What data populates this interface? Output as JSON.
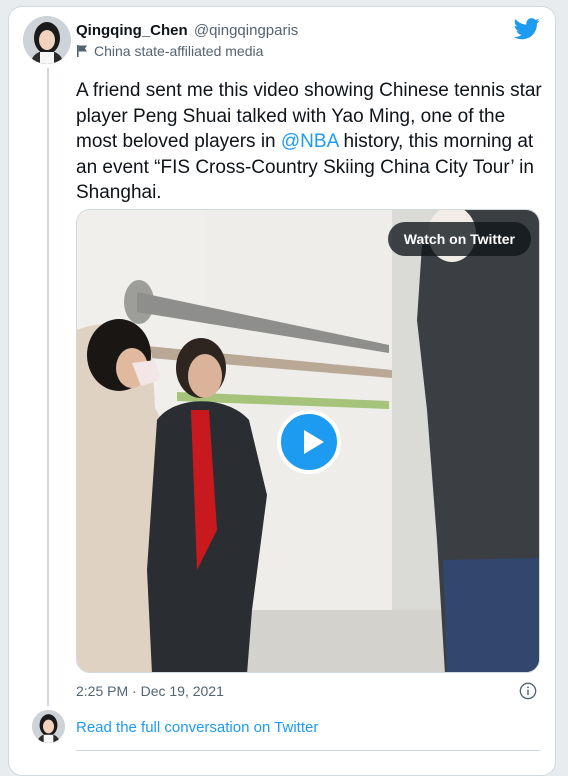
{
  "author": {
    "display_name": "Qingqing_Chen",
    "handle": "@qingqingparis",
    "affiliation": "China state-affiliated media"
  },
  "tweet": {
    "text_before": "A friend sent me this video showing Chinese tennis star player Peng Shuai talked with Yao Ming, one of the most beloved players in ",
    "mention": "@NBA",
    "text_after": " history, this morning at an event “FIS Cross-Country Skiing China City Tour’ in Shanghai.",
    "timestamp": "2:25 PM · Dec 19, 2021"
  },
  "media": {
    "watch_label": "Watch on Twitter"
  },
  "footer": {
    "read_label": "Read the full conversation on Twitter"
  },
  "icons": {
    "brand": "twitter-bird-icon",
    "affiliation": "flag-icon",
    "play": "play-icon",
    "info": "info-icon"
  },
  "colors": {
    "accent": "#1d9bf0",
    "secondary_text": "#536471",
    "border": "#cfd9de"
  }
}
